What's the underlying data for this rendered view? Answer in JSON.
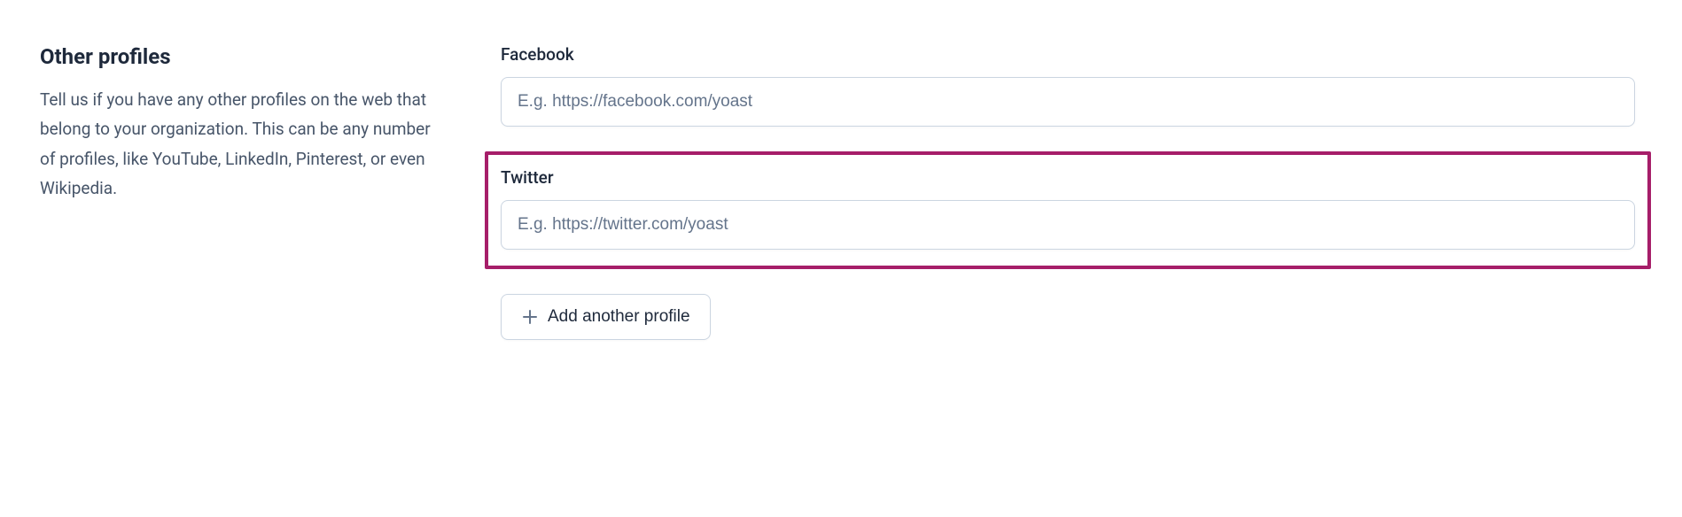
{
  "sidebar": {
    "title": "Other profiles",
    "description": "Tell us if you have any other profiles on the web that belong to your organization. This can be any number of profiles, like YouTube, LinkedIn, Pinterest, or even Wikipedia."
  },
  "fields": [
    {
      "label": "Facebook",
      "placeholder": "E.g. https://facebook.com/yoast",
      "value": "",
      "highlighted": false
    },
    {
      "label": "Twitter",
      "placeholder": "E.g. https://twitter.com/yoast",
      "value": "",
      "highlighted": true
    }
  ],
  "add_button": {
    "label": "Add another profile"
  }
}
